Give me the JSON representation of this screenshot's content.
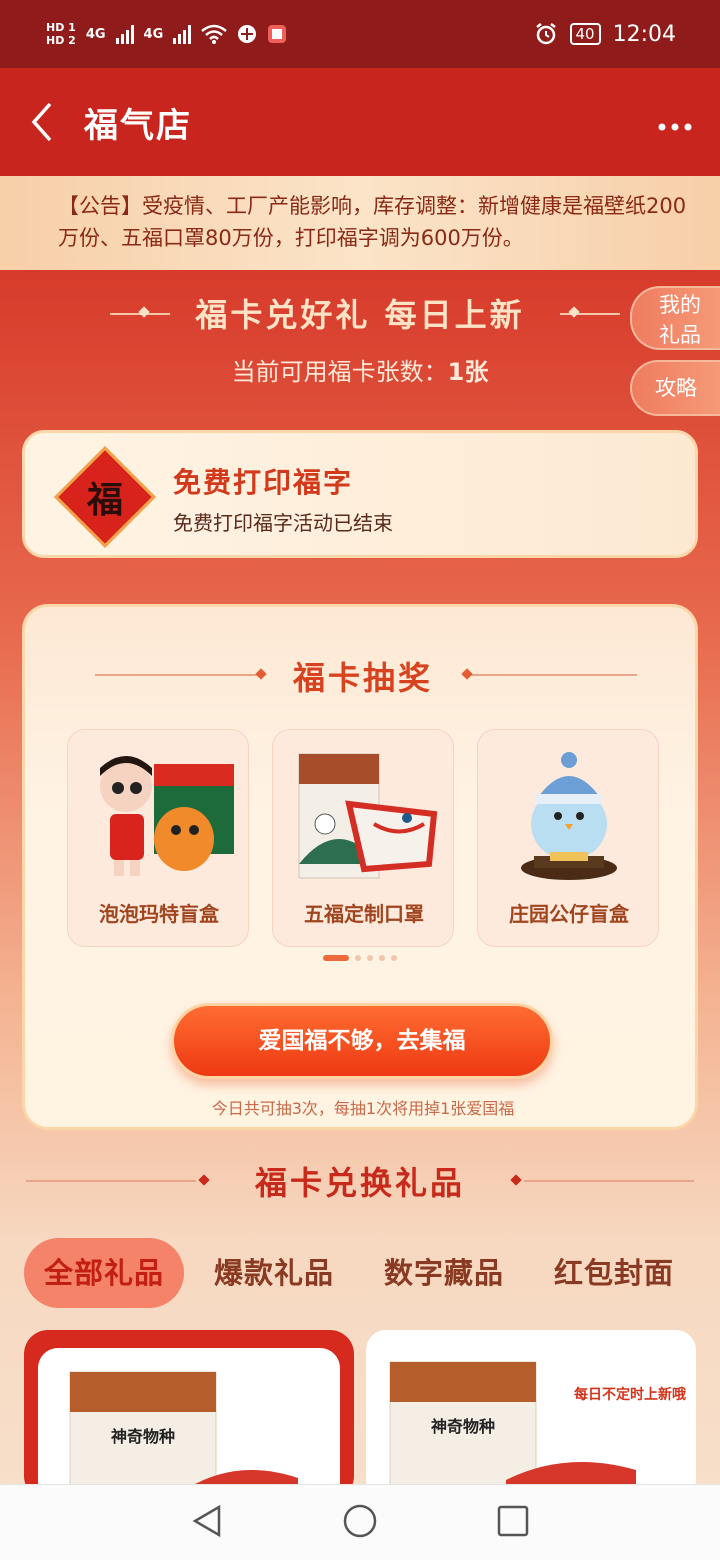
{
  "status_bar": {
    "hd1": "HD 1",
    "hd2": "HD 2",
    "net1": "4G",
    "net2": "4G",
    "battery": "40",
    "time": "12:04"
  },
  "nav": {
    "title": "福气店"
  },
  "notice": {
    "text": "【公告】受疫情、工厂产能影响，库存调整：新增健康是福壁纸200万份、五福口罩80万份，打印福字调为600万份。"
  },
  "hero": {
    "title": "福卡兑好礼 每日上新",
    "count_label": "当前可用福卡张数：",
    "count_value": "1张"
  },
  "side_buttons": {
    "my_gifts": "我的礼品",
    "guide": "攻略"
  },
  "print_card": {
    "icon_char": "福",
    "title": "免费打印福字",
    "subtitle": "免费打印福字活动已结束"
  },
  "lottery": {
    "title": "福卡抽奖",
    "prizes": [
      {
        "label": "泡泡玛特盲盒"
      },
      {
        "label": "五福定制口罩"
      },
      {
        "label": "庄园公仔盲盒"
      }
    ],
    "cta": "爱国福不够，去集福",
    "note": "今日共可抽3次，每抽1次将用掉1张爱国福"
  },
  "exchange": {
    "title": "福卡兑换礼品",
    "tabs": [
      {
        "label": "全部礼品"
      },
      {
        "label": "爆款礼品"
      },
      {
        "label": "数字藏品"
      },
      {
        "label": "红包封面"
      }
    ],
    "goods": [
      {
        "product": "神奇物种"
      },
      {
        "product": "神奇物种",
        "tag": "每日不定时上新哦"
      }
    ]
  },
  "colors": {
    "brand_red": "#c9251f",
    "status_red": "#8f1c1a",
    "accent_orange": "#ee3912"
  }
}
